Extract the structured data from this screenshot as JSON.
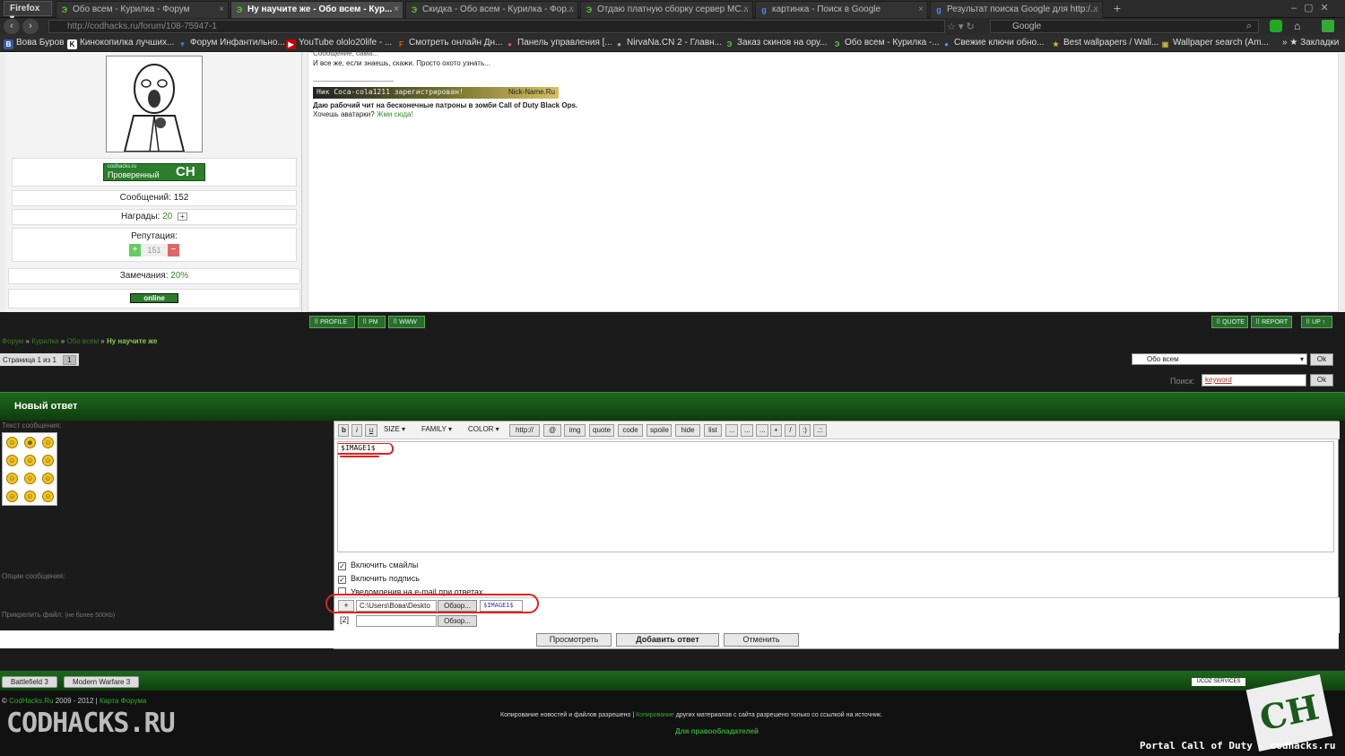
{
  "browser": {
    "app_button": "Firefox ▾",
    "tabs": [
      {
        "label": "Обо всем - Курилка - Форум",
        "active": false,
        "icon": "Э"
      },
      {
        "label": "Ну научите же - Обо всем - Кур...",
        "active": true,
        "icon": "Э"
      },
      {
        "label": "Скидка - Обо всем - Курилка - Фор...",
        "active": false,
        "icon": "Э"
      },
      {
        "label": "Отдаю платную сборку сервер MC...",
        "active": false,
        "icon": "Э"
      },
      {
        "label": "картинка - Поиск в Google",
        "active": false,
        "icon": "g"
      },
      {
        "label": "Результат поиска Google для http:/...",
        "active": false,
        "icon": "g"
      }
    ],
    "new_tab": "+",
    "url": "http://codhacks.ru/forum/108-75947-1",
    "search_placeholder": "Google",
    "bookmarks": [
      {
        "label": "Вова Буров",
        "color": "#3a5a9a",
        "icon": "B"
      },
      {
        "label": "Кинокопилка лучших...",
        "color": "#ffffff",
        "icon": "K"
      },
      {
        "label": "Форум Инфантильно...",
        "color": "#4a7ad0",
        "icon": "▼"
      },
      {
        "label": "YouTube ololo20life - ...",
        "color": "#c00",
        "icon": "▶"
      },
      {
        "label": "Смотреть онлайн Дн...",
        "color": "#e05a00",
        "icon": "F"
      },
      {
        "label": "Панель управления [...",
        "color": "#d55",
        "icon": "●"
      },
      {
        "label": "NirvaNa.CN 2 - Главн...",
        "color": "#777",
        "icon": "●"
      },
      {
        "label": "Заказ скинов на ору...",
        "color": "#2a8a2a",
        "icon": "Э"
      },
      {
        "label": "Обо всем - Курилка -...",
        "color": "#2a8a2a",
        "icon": "Э"
      },
      {
        "label": "Свежие ключи обно...",
        "color": "#2a6aaa",
        "icon": "●"
      },
      {
        "label": "Best wallpapers / Wall...",
        "color": "#b09030",
        "icon": "★"
      },
      {
        "label": "Wallpaper search (Am...",
        "color": "#b09030",
        "icon": "▣"
      }
    ],
    "bookmarks_folder": "Закладки"
  },
  "profile": {
    "verified_site": "codhacks.ru",
    "verified_label": "Проверенный",
    "verified_logo": "CH",
    "messages": "Сообщений: 152",
    "awards_label": "Награды:",
    "awards_value": "20",
    "reputation_label": "Репутация:",
    "reputation_value": "151",
    "plus": "+",
    "minus": "−",
    "warnings_label": "Замечания:",
    "warnings_value": "20%",
    "status": "online"
  },
  "post": {
    "line1": "Сообщение, сама...",
    "line2": "И все же, если знаешь, скажи. Просто охото узнать...",
    "banner_text": "Ник Coca-cola1211 зарегистрирован!",
    "banner_site": "Nick-Name.Ru",
    "sig_line1": "Даю рабочий чит на бесконечные патроны в зомби Call of Duty Black Ops.",
    "sig_line2a": "Хочешь аватарки?",
    "sig_line2b": "Жми сюда!"
  },
  "post_buttons": {
    "profile": "PROFILE",
    "pm": "PM",
    "www": "WWW",
    "quote": "QUOTE",
    "report": "REPORT",
    "up": "UP ↑"
  },
  "breadcrumb": {
    "items": [
      "Форум",
      "Курилка",
      "Обо всем"
    ],
    "current": "Ну научите же",
    "sep": "»"
  },
  "pagination": {
    "label": "Страница 1 из 1",
    "page": "1"
  },
  "forum_select": {
    "value": "Обо всем",
    "ok": "Ok"
  },
  "search": {
    "label": "Поиск:",
    "value": "keyword",
    "ok": "Ok"
  },
  "reply": {
    "title": "Новый ответ",
    "text_label": "Текст сообщения:",
    "options_label": "Опции сообщения:",
    "attach_label": "Прикрепить файл:",
    "attach_hint": "(не более 500Кb)",
    "toolbar": [
      "b",
      "i",
      "u",
      "SIZE",
      "FAMILY",
      "COLOR",
      "http://",
      "@",
      "img",
      "quote",
      "code",
      "spoile",
      "hide",
      "list",
      "...",
      "...",
      "...",
      "+",
      "/",
      ":)",
      ".::"
    ],
    "content": "$IMAGE1$",
    "option_smilies": "Включить смайлы",
    "option_signature": "Включить подпись",
    "option_email": "Уведомления на e-mail при ответах",
    "file1_num": "+",
    "file1_path": "C:\\Users\\Вова\\Deskto",
    "browse": "Обзор...",
    "file1_tag": "$IMAGE1$",
    "file2_num": "[2]",
    "btn_preview": "Просмотреть",
    "btn_submit": "Добавить ответ",
    "btn_cancel": "Отменить"
  },
  "footer": {
    "game1": "Battlefield 3",
    "game2": "Modern Warfare 3",
    "copyright_prefix": "©",
    "copyright_site": "CodHacks.Ru",
    "copyright_years": "2009 - 2012 |",
    "sitemap": "Карта Форума",
    "logo": "CODHACKS.RU",
    "notice_a": "Копирование новостей и файлов разрешено |",
    "notice_b": "Копирование",
    "notice_c": "других материалов с сайта разрешено только со ссылкой на источник.",
    "legal": "Для правообладателей",
    "ucoz": "UCOZ SERVICES",
    "ch_logo": "CH",
    "portal": "Portal Call of Duty - codhacks.ru"
  },
  "colors": {
    "accent": "#1e6a1e",
    "link": "#3a7a2a",
    "annotation": "#dd2222"
  }
}
